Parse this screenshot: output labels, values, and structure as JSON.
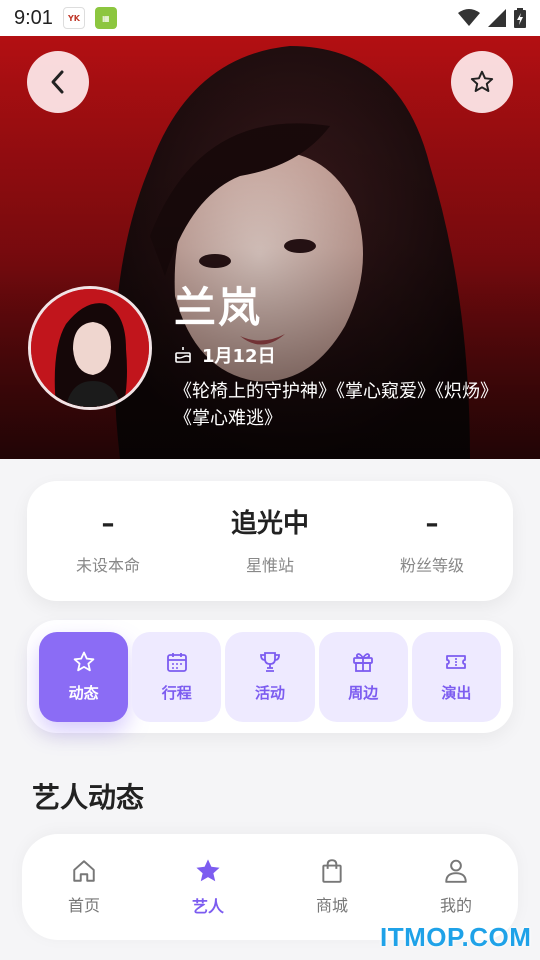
{
  "status_bar": {
    "time": "9:01",
    "app_icons": [
      "yk-app-icon",
      "green-app-icon"
    ]
  },
  "hero": {
    "artist_name": "兰岚",
    "birthday": "1月12日",
    "works": "《轮椅上的守护神》《掌心窥爱》《炽炀》《掌心难逃》"
  },
  "stats": [
    {
      "value": "–",
      "label": "未设本命"
    },
    {
      "value": "追光中",
      "label": "星惟站"
    },
    {
      "value": "–",
      "label": "粉丝等级"
    }
  ],
  "tabs": [
    {
      "label": "动态",
      "icon": "star-icon",
      "active": true
    },
    {
      "label": "行程",
      "icon": "calendar-icon",
      "active": false
    },
    {
      "label": "活动",
      "icon": "trophy-icon",
      "active": false
    },
    {
      "label": "周边",
      "icon": "gift-icon",
      "active": false
    },
    {
      "label": "演出",
      "icon": "ticket-icon",
      "active": false
    }
  ],
  "section_title": "艺人动态",
  "bottom_nav": [
    {
      "label": "首页",
      "icon": "home-icon",
      "active": false
    },
    {
      "label": "艺人",
      "icon": "star-icon",
      "active": true
    },
    {
      "label": "商城",
      "icon": "shopping-bag-icon",
      "active": false
    },
    {
      "label": "我的",
      "icon": "person-icon",
      "active": false
    }
  ],
  "watermark": "ITMOP.COM",
  "colors": {
    "accent": "#8b6cf5",
    "accent_light": "#eeeaff",
    "hero_red": "#b30f12"
  }
}
